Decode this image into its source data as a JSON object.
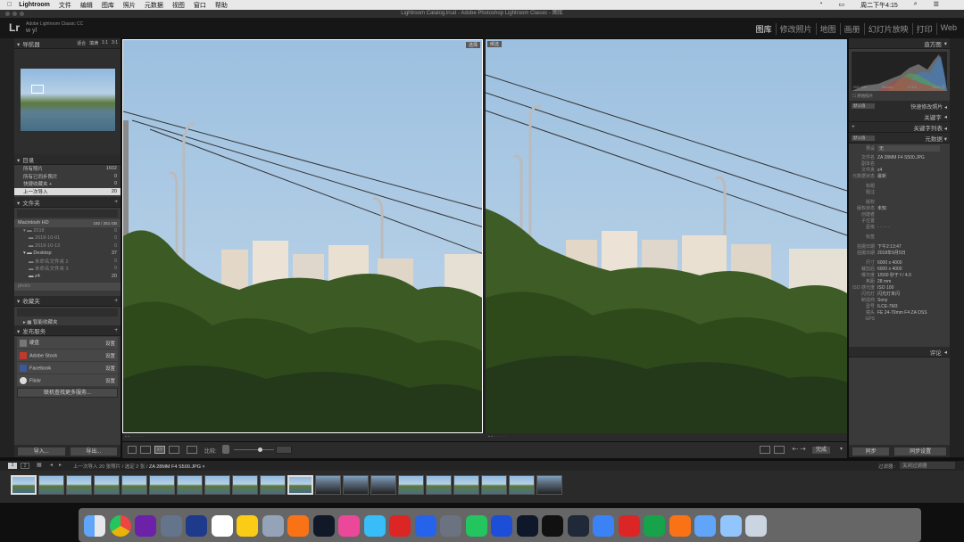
{
  "menubar": {
    "app": "Lightroom",
    "items": [
      "文件",
      "编辑",
      "图库",
      "照片",
      "元数据",
      "视图",
      "窗口",
      "帮助"
    ],
    "clock": "周二下午4:15"
  },
  "window_title": "Lightroom Catalog.lrcat - Adobe Photoshop Lightroom Classic - 图库",
  "identity": {
    "logo": "Lr",
    "product": "Adobe Lightroom Classic CC",
    "user": "w yl"
  },
  "modules": [
    "图库",
    "修改照片",
    "地图",
    "画册",
    "幻灯片放映",
    "打印",
    "Web"
  ],
  "left": {
    "navigator": {
      "title": "导航器",
      "zoom": [
        "适合",
        "填满",
        "1:1",
        "3:1"
      ]
    },
    "catalog": {
      "title": "目录",
      "rows": [
        {
          "label": "所有照片",
          "count": "1602"
        },
        {
          "label": "所有已同步照片",
          "count": "0"
        },
        {
          "label": "快捷收藏夹 +",
          "count": "0"
        },
        {
          "label": "上一次导入",
          "count": "20"
        }
      ]
    },
    "folders": {
      "title": "文件夹",
      "drive": "Macintosh HD",
      "drive_size": "192 / 251 GB",
      "rows": [
        {
          "label": "2018",
          "count": "0"
        },
        {
          "label": "2018-10-01",
          "count": "0"
        },
        {
          "label": "2018-10-13",
          "count": "0"
        },
        {
          "label": "Desktop",
          "count": "37"
        },
        {
          "label": "未命名文件夹 2",
          "count": "0"
        },
        {
          "label": "未命名文件夹 3",
          "count": "0"
        },
        {
          "label": "z4",
          "count": "20"
        },
        {
          "label": "photo",
          "count": ""
        }
      ]
    },
    "collections": {
      "title": "收藏夹",
      "row": "智能收藏夹"
    },
    "publish": {
      "title": "发布服务",
      "rows": [
        {
          "label": "硬盘",
          "btn": "设置"
        },
        {
          "label": "Adobe Stock",
          "btn": "设置"
        },
        {
          "label": "Facebook",
          "btn": "设置"
        },
        {
          "label": "Flickr",
          "btn": "设置"
        }
      ],
      "more": "联机查找更多服务..."
    },
    "import": "导入...",
    "export": "导出..."
  },
  "viewer": {
    "select_tag": "选择",
    "candidate_tag": "候选",
    "compare_label": "比较:",
    "done": "完成"
  },
  "right": {
    "histogram_title": "直方图",
    "histogram_info": [
      "ISO 100",
      "28 mm",
      "f / 4.0",
      "1/500 秒"
    ],
    "original_photo": "原始照片",
    "quick_develop": "快速修改照片",
    "keywording": "关键字",
    "keyword_list": "关键字列表",
    "metadata": "元数据",
    "default_select": "默认值",
    "preset": "预设",
    "preset_val": "无",
    "fields": [
      {
        "k": "文件名",
        "v": "ZA 28MM F4 S500.JPG"
      },
      {
        "k": "副本名",
        "v": ""
      },
      {
        "k": "文件夹",
        "v": "z4"
      },
      {
        "k": "元数据状态",
        "v": "最新"
      },
      {
        "k": "标题",
        "v": ""
      },
      {
        "k": "题注",
        "v": ""
      },
      {
        "k": "版权",
        "v": ""
      },
      {
        "k": "版权状态",
        "v": "未知"
      },
      {
        "k": "创建者",
        "v": ""
      },
      {
        "k": "子位置",
        "v": ""
      },
      {
        "k": "星级",
        "v": "· · · · ·"
      },
      {
        "k": "标签",
        "v": ""
      },
      {
        "k": "拍摄日期",
        "v": "下午2:13:47"
      },
      {
        "k": "拍摄日期",
        "v": "2018年9月5日"
      },
      {
        "k": "尺寸",
        "v": "6000 x 4000"
      },
      {
        "k": "裁剪后",
        "v": "6000 x 4000"
      },
      {
        "k": "曝光度",
        "v": "1/500 秒于 f / 4.0"
      },
      {
        "k": "焦距",
        "v": "28 mm"
      },
      {
        "k": "ISO 感光度",
        "v": "ISO 100"
      },
      {
        "k": "闪光灯",
        "v": "闪光灯未闪"
      },
      {
        "k": "制造商",
        "v": "Sony"
      },
      {
        "k": "型号",
        "v": "ILCE-7M3"
      },
      {
        "k": "镜头",
        "v": "FE 24-70mm F4 ZA OSS"
      },
      {
        "k": "GPS",
        "v": ""
      }
    ],
    "comments": "评论",
    "sync": "同步",
    "sync_settings": "同步设置"
  },
  "filmstrip": {
    "info": "上一次导入 20 张照片 / 选定 2 张 /",
    "file": "ZA 28MM F4 S500.JPG",
    "filter_label": "过滤器 :",
    "filter_value": "关闭过滤器"
  },
  "dock": [
    "Finder",
    "Chrome",
    "Siri",
    "Launchpad",
    "QuickTime",
    "Calendar",
    "Notes",
    "Preview",
    "Photos",
    "FCP",
    "Music",
    "Telegram",
    "Netease",
    "AppStore",
    "Prefs",
    "WeChat",
    "Word",
    "Ps",
    "QQ",
    "Lr",
    "Mail",
    "Acrobat",
    "Spotify",
    "Books",
    "Folder",
    "Downloads",
    "Trash"
  ]
}
